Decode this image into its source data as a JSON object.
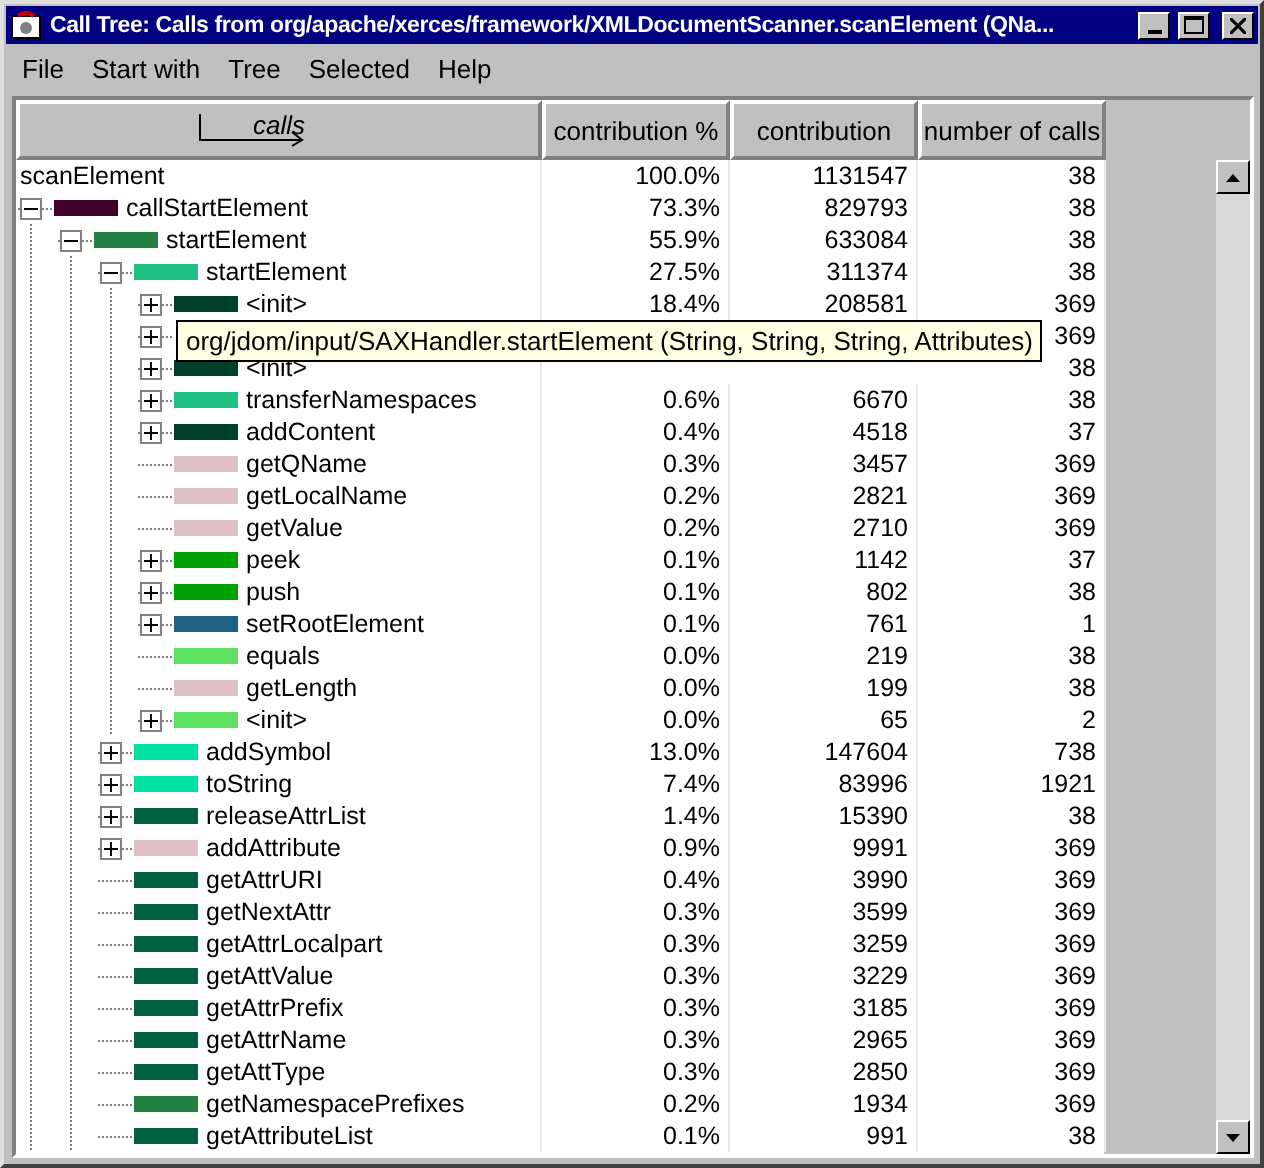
{
  "window": {
    "title": "Call Tree: Calls from org/apache/xerces/framework/XMLDocumentScanner.scanElement (QNa..."
  },
  "menu": [
    "File",
    "Start with",
    "Tree",
    "Selected",
    "Help"
  ],
  "table": {
    "columns": [
      {
        "label": "calls",
        "kind": "tree"
      },
      {
        "label": "contribution %",
        "kind": "text"
      },
      {
        "label": "contribution",
        "kind": "text"
      },
      {
        "label": "number of calls",
        "kind": "text"
      }
    ],
    "rows": [
      {
        "name": "scanElement",
        "pct": "100.0%",
        "contribution": "1131547",
        "calls": "38",
        "children": [
          {
            "name": "callStartElement",
            "pct": "73.3%",
            "contribution": "829793",
            "calls": "38",
            "color": "#40002a",
            "expanded": true,
            "children": [
              {
                "name": "startElement",
                "pct": "55.9%",
                "contribution": "633084",
                "calls": "38",
                "color": "#208040",
                "expanded": true,
                "children": [
                  {
                    "name": "startElement",
                    "pct": "27.5%",
                    "contribution": "311374",
                    "calls": "38",
                    "color": "#20c080",
                    "expanded": true,
                    "children": [
                      {
                        "name": "<init>",
                        "pct": "18.4%",
                        "contribution": "208581",
                        "calls": "369",
                        "color": "#004028",
                        "expanded": false
                      },
                      {
                        "calls": "369",
                        "expanded": false
                      },
                      {
                        "name": "<init>",
                        "calls": "38",
                        "color": "#004028",
                        "expanded": false
                      },
                      {
                        "name": "transferNamespaces",
                        "pct": "0.6%",
                        "contribution": "6670",
                        "calls": "38",
                        "color": "#20c080",
                        "expanded": false
                      },
                      {
                        "name": "addContent",
                        "pct": "0.4%",
                        "contribution": "4518",
                        "calls": "37",
                        "color": "#004028",
                        "expanded": false
                      },
                      {
                        "name": "getQName",
                        "pct": "0.3%",
                        "contribution": "3457",
                        "calls": "369",
                        "color": "#e0c0c0"
                      },
                      {
                        "name": "getLocalName",
                        "pct": "0.2%",
                        "contribution": "2821",
                        "calls": "369",
                        "color": "#e0c0c0"
                      },
                      {
                        "name": "getValue",
                        "pct": "0.2%",
                        "contribution": "2710",
                        "calls": "369",
                        "color": "#e0c0c0"
                      },
                      {
                        "name": "peek",
                        "pct": "0.1%",
                        "contribution": "1142",
                        "calls": "37",
                        "color": "#00a000",
                        "expanded": false
                      },
                      {
                        "name": "push",
                        "pct": "0.1%",
                        "contribution": "802",
                        "calls": "38",
                        "color": "#00a000",
                        "expanded": false
                      },
                      {
                        "name": "setRootElement",
                        "pct": "0.1%",
                        "contribution": "761",
                        "calls": "1",
                        "color": "#206080",
                        "expanded": false
                      },
                      {
                        "name": "equals",
                        "pct": "0.0%",
                        "contribution": "219",
                        "calls": "38",
                        "color": "#60e060"
                      },
                      {
                        "name": "getLength",
                        "pct": "0.0%",
                        "contribution": "199",
                        "calls": "38",
                        "color": "#e0c0c0"
                      },
                      {
                        "name": "<init>",
                        "pct": "0.0%",
                        "contribution": "65",
                        "calls": "2",
                        "color": "#60e060",
                        "expanded": false
                      }
                    ]
                  },
                  {
                    "name": "addSymbol",
                    "pct": "13.0%",
                    "contribution": "147604",
                    "calls": "738",
                    "color": "#00e0a0",
                    "expanded": false
                  },
                  {
                    "name": "toString",
                    "pct": "7.4%",
                    "contribution": "83996",
                    "calls": "1921",
                    "color": "#00e0a0",
                    "expanded": false
                  },
                  {
                    "name": "releaseAttrList",
                    "pct": "1.4%",
                    "contribution": "15390",
                    "calls": "38",
                    "color": "#006040",
                    "expanded": false
                  },
                  {
                    "name": "addAttribute",
                    "pct": "0.9%",
                    "contribution": "9991",
                    "calls": "369",
                    "color": "#e0c0c0",
                    "expanded": false
                  },
                  {
                    "name": "getAttrURI",
                    "pct": "0.4%",
                    "contribution": "3990",
                    "calls": "369",
                    "color": "#006040"
                  },
                  {
                    "name": "getNextAttr",
                    "pct": "0.3%",
                    "contribution": "3599",
                    "calls": "369",
                    "color": "#006040"
                  },
                  {
                    "name": "getAttrLocalpart",
                    "pct": "0.3%",
                    "contribution": "3259",
                    "calls": "369",
                    "color": "#006040"
                  },
                  {
                    "name": "getAttValue",
                    "pct": "0.3%",
                    "contribution": "3229",
                    "calls": "369",
                    "color": "#006040"
                  },
                  {
                    "name": "getAttrPrefix",
                    "pct": "0.3%",
                    "contribution": "3185",
                    "calls": "369",
                    "color": "#006040"
                  },
                  {
                    "name": "getAttrName",
                    "pct": "0.3%",
                    "contribution": "2965",
                    "calls": "369",
                    "color": "#006040"
                  },
                  {
                    "name": "getAttType",
                    "pct": "0.3%",
                    "contribution": "2850",
                    "calls": "369",
                    "color": "#006040"
                  },
                  {
                    "name": "getNamespacePrefixes",
                    "pct": "0.2%",
                    "contribution": "1934",
                    "calls": "369",
                    "color": "#208040"
                  },
                  {
                    "name": "getAttributeList",
                    "pct": "0.1%",
                    "contribution": "991",
                    "calls": "38",
                    "color": "#006040"
                  }
                ]
              }
            ]
          }
        ]
      }
    ]
  },
  "tooltip": "org/jdom/input/SAXHandler.startElement (String, String, String, Attributes)"
}
